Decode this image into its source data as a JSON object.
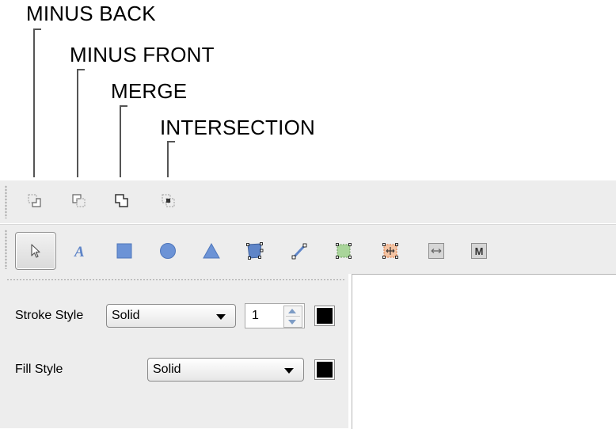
{
  "annotations": {
    "minus_back": "MINUS BACK",
    "minus_front": "MINUS FRONT",
    "merge": "MERGE",
    "intersection": "INTERSECTION"
  },
  "boolean_toolbar": {
    "icons": [
      "minus-back-icon",
      "minus-front-icon",
      "merge-icon",
      "intersection-icon"
    ]
  },
  "tools_toolbar": {
    "icons": [
      "select-arrow-icon",
      "text-tool-icon",
      "rectangle-tool-icon",
      "ellipse-tool-icon",
      "triangle-tool-icon",
      "polygon-tool-icon",
      "line-tool-icon",
      "node-edit-icon",
      "transform-icon",
      "flip-arrows-icon",
      "m-icon"
    ],
    "m_label": "M",
    "selected": "select-arrow-icon"
  },
  "properties": {
    "stroke_style_label": "Stroke Style",
    "stroke_style_value": "Solid",
    "stroke_width": "1",
    "stroke_color": "#000000",
    "fill_style_label": "Fill Style",
    "fill_style_value": "Solid",
    "fill_color": "#000000"
  },
  "colors": {
    "accent_blue": "#6c93d6",
    "toolbar_bg": "#ededed"
  }
}
